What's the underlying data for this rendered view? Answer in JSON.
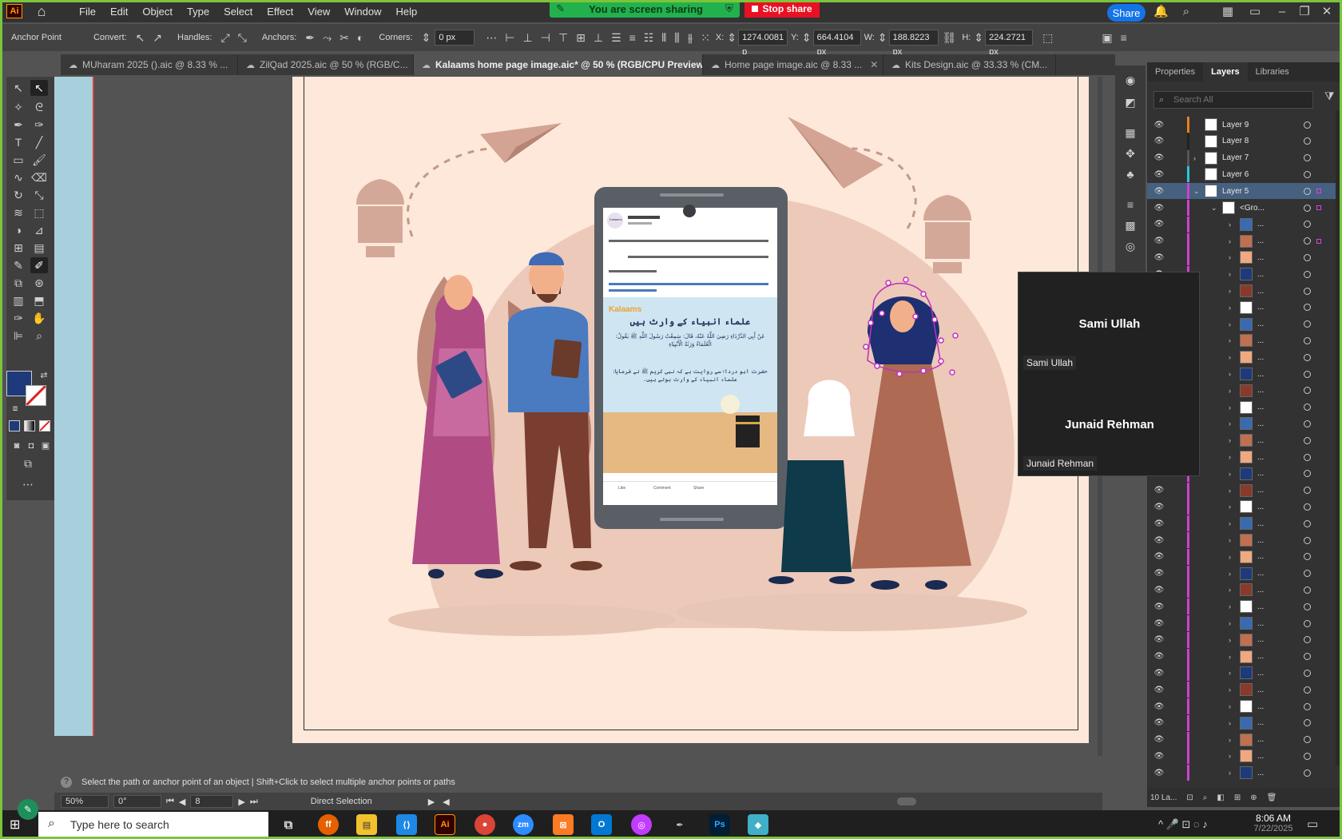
{
  "app": {
    "logo": "Ai",
    "menus": [
      "File",
      "Edit",
      "Object",
      "Type",
      "Select",
      "Effect",
      "View",
      "Window",
      "Help"
    ],
    "screen_share_text": "You are screen sharing",
    "stop_share_label": "Stop share",
    "share_label": "Share"
  },
  "control_bar": {
    "anchor_point_label": "Anchor Point",
    "convert_label": "Convert:",
    "handles_label": "Handles:",
    "anchors_label": "Anchors:",
    "corners_label": "Corners:",
    "corners_value": "0 px",
    "x_label": "X:",
    "x_value": "1274.0081 p",
    "y_label": "Y:",
    "y_value": "664.4104 px",
    "w_label": "W:",
    "w_value": "188.8223 px",
    "h_label": "H:",
    "h_value": "224.2721 px"
  },
  "tabs": [
    {
      "label": "MUharam 2025 ().aic @ 8.33 % ...",
      "active": false
    },
    {
      "label": "ZilQad 2025.aic @ 50 % (RGB/C...",
      "active": false
    },
    {
      "label": "Kalaams home page image.aic* @ 50 % (RGB/CPU Preview)",
      "active": true
    },
    {
      "label": "Home page image.aic @ 8.33 ...",
      "active": false
    },
    {
      "label": "Kits Design.aic @ 33.33 % (CM...",
      "active": false
    }
  ],
  "panel": {
    "tabs": [
      "Properties",
      "Layers",
      "Libraries"
    ],
    "active_tab": "Layers",
    "search_placeholder": "Search All",
    "layers": [
      {
        "name": "Layer 9",
        "color": "#e8801a",
        "arrow": "",
        "highlighted": false
      },
      {
        "name": "Layer 8",
        "color": "#222222",
        "arrow": "",
        "highlighted": false
      },
      {
        "name": "Layer 7",
        "color": "#555555",
        "arrow": ">",
        "highlighted": false
      },
      {
        "name": "Layer 6",
        "color": "#28c8d8",
        "arrow": "",
        "highlighted": false
      },
      {
        "name": "Layer 5",
        "color": "#d040d0",
        "arrow": "v",
        "highlighted": true
      },
      {
        "name": "<Gro...",
        "color": "#d040d0",
        "arrow": "v",
        "highlighted": false
      }
    ],
    "sublayer_name": "...",
    "footer_label": "10 La..."
  },
  "zoom_overlay": {
    "participant1_name": "Sami Ullah",
    "participant1_tag": "Sami Ullah",
    "participant2_name": "Junaid Rehman",
    "participant2_tag": "Junaid Rehman"
  },
  "phone_post": {
    "page_name": "Kalaams",
    "brand": "Kalaams",
    "urdu_title": "علماء انبیاء کے وارث ہیں",
    "arabic_text": "عَنْ أَبِي الدَّرْدَاءِ رَضِيَ اللَّهُ عَنْهُ، قَالَ: سَمِعْتُ رَسُولَ اللَّهِ ﷺ يَقُولُ: الْعُلَمَاءُ وَرَثَةُ الْأَنْبِيَاءِ",
    "urdu_text": "حضرت ابو درداءؓ سے روایت ہے کہ نبی کریم ﷺ نے فرمایا: علماء انبیاء کے وارث ہوتے ہیں۔",
    "like": "Like",
    "comment": "Comment",
    "share": "Share"
  },
  "status": {
    "hint": "Select the path or anchor point of an object  |  Shift+Click to select multiple anchor points or paths",
    "zoom": "50%",
    "rotation": "0°",
    "artboard_number": "8",
    "tool_name": "Direct Selection"
  },
  "taskbar": {
    "search_placeholder": "Type here to search",
    "time": "8:06 AM",
    "date": "7/22/2025"
  },
  "colors": {
    "accent_blue": "#1473e6",
    "share_green": "#22b14c",
    "stop_red": "#e81123",
    "artboard_bg": "#fde8da",
    "fill_swatch": "#1e3a7a"
  }
}
